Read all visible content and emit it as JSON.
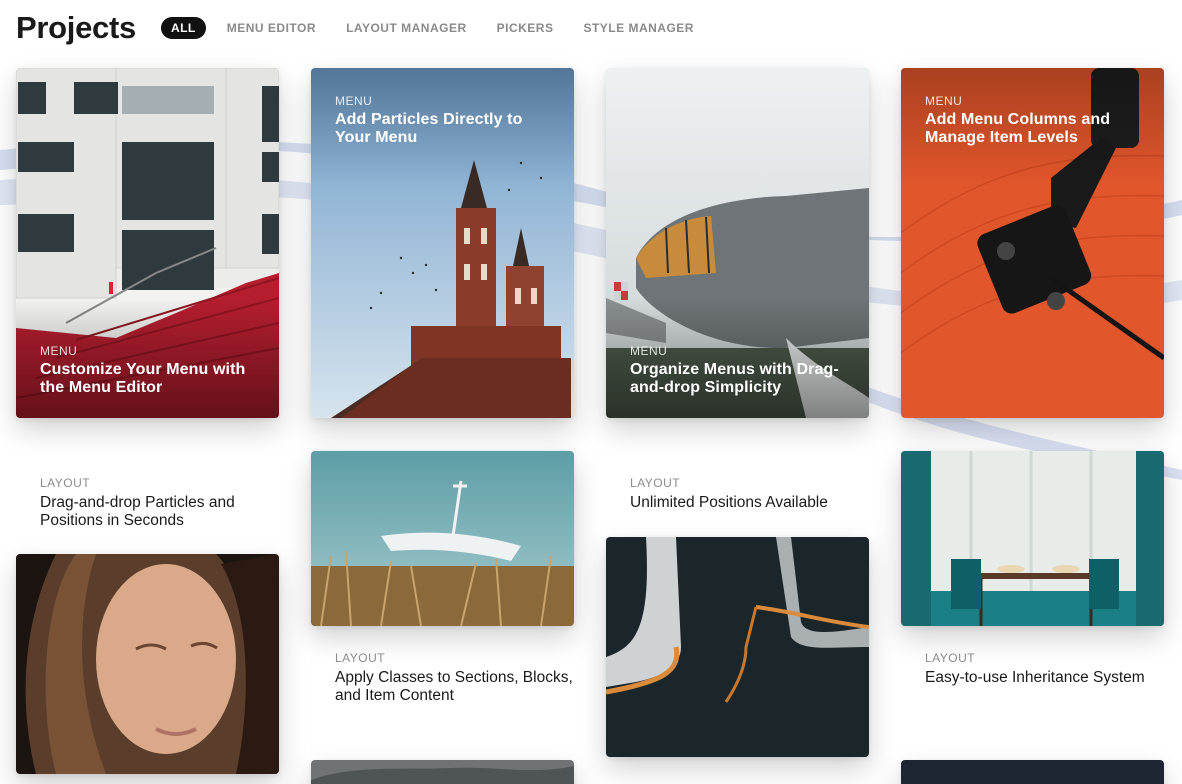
{
  "header": {
    "title": "Projects"
  },
  "filters": [
    {
      "label": "ALL",
      "active": true
    },
    {
      "label": "MENU EDITOR",
      "active": false
    },
    {
      "label": "LAYOUT MANAGER",
      "active": false
    },
    {
      "label": "PICKERS",
      "active": false
    },
    {
      "label": "STYLE MANAGER",
      "active": false
    }
  ],
  "cards": [
    {
      "category": "MENU",
      "title": "Customize Your Menu with the Menu Editor",
      "image": "building-red-stairs"
    },
    {
      "category": "MENU",
      "title": "Add Particles Directly to Your Menu",
      "image": "church-tower-sky"
    },
    {
      "category": "MENU",
      "title": "Organize Menus with Drag-and-drop Simplicity",
      "image": "vintage-airplane"
    },
    {
      "category": "MENU",
      "title": "Add Menu Columns and Manage Item Levels",
      "image": "record-player-orange"
    },
    {
      "category": "LAYOUT",
      "title": "Drag-and-drop Particles and Positions in Seconds"
    },
    {
      "category": "",
      "title": "",
      "image": "woman-portrait"
    },
    {
      "category": "",
      "title": "",
      "image": "radio-dish-field"
    },
    {
      "category": "LAYOUT",
      "title": "Apply Classes to Sections, Blocks, and Item Content"
    },
    {
      "category": "LAYOUT",
      "title": "Unlimited Positions Available"
    },
    {
      "category": "",
      "title": "",
      "image": "laptop-edges-dark"
    },
    {
      "category": "",
      "title": "",
      "image": "teal-dining-room"
    },
    {
      "category": "LAYOUT",
      "title": "Easy-to-use Inheritance System"
    }
  ]
}
